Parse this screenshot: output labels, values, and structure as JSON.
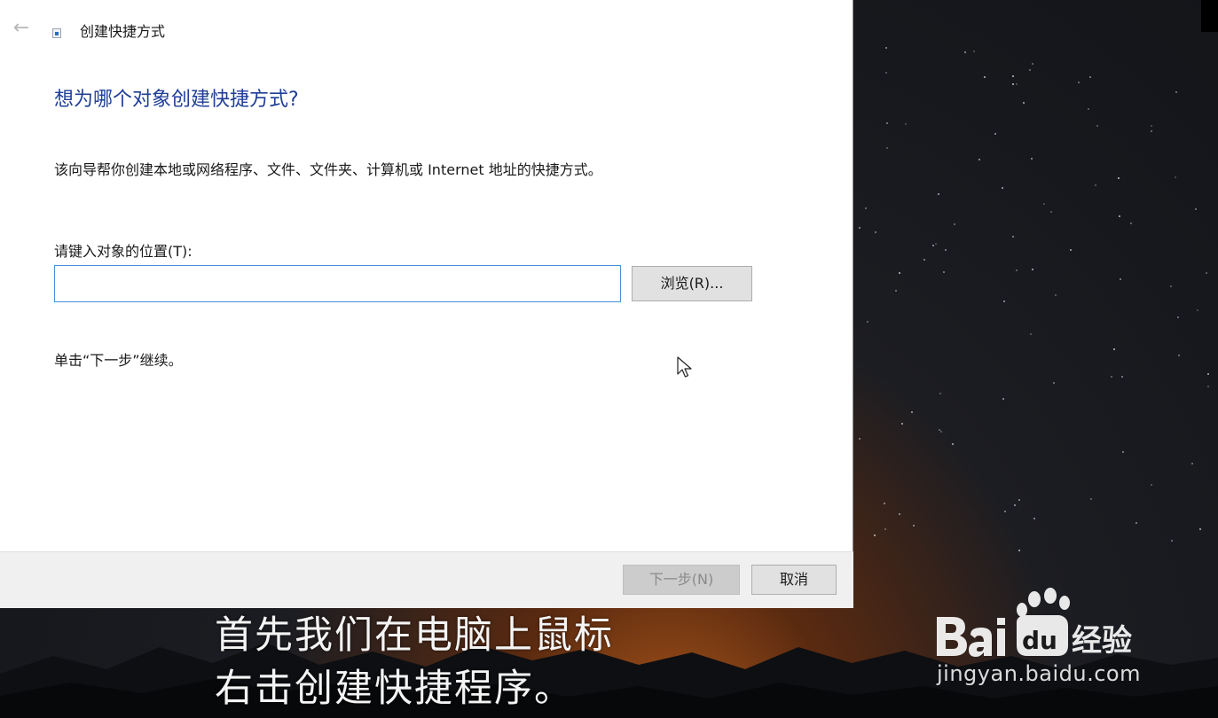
{
  "dialog": {
    "title": "创建快捷方式",
    "heading": "想为哪个对象创建快捷方式?",
    "description": "该向导帮你创建本地或网络程序、文件、文件夹、计算机或 Internet 地址的快捷方式。",
    "location_label": "请键入对象的位置(T):",
    "location_value": "",
    "browse_label": "浏览(R)...",
    "hint": "单击“下一步”继续。",
    "next_label": "下一步(N)",
    "cancel_label": "取消"
  },
  "subtitles": {
    "line1": "首先我们在电脑上鼠标",
    "line2": "右击创建快捷程序。"
  },
  "watermark": {
    "brand": "Baidu经验",
    "url": "jingyan.baidu.com"
  },
  "colors": {
    "heading": "#1f3e96",
    "input_border": "#4a90d9",
    "footer_bg": "#f0f0f0"
  },
  "icons": [
    "back-arrow-icon",
    "shortcut-icon",
    "mouse-cursor-icon"
  ]
}
